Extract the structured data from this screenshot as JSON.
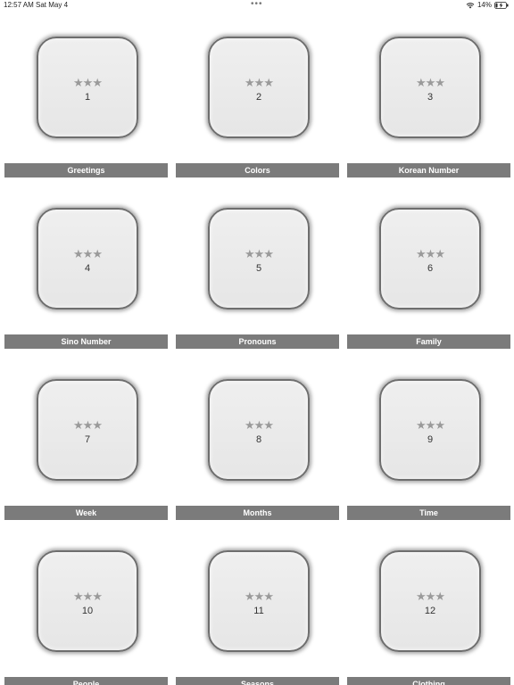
{
  "status": {
    "time": "12:57 AM",
    "date": "Sat May 4",
    "battery": "14%"
  },
  "stars_glyph": "★★★",
  "tiles": [
    {
      "number": "1",
      "label": "Greetings"
    },
    {
      "number": "2",
      "label": "Colors"
    },
    {
      "number": "3",
      "label": "Korean Number"
    },
    {
      "number": "4",
      "label": "Sino Number"
    },
    {
      "number": "5",
      "label": "Pronouns"
    },
    {
      "number": "6",
      "label": "Family"
    },
    {
      "number": "7",
      "label": "Week"
    },
    {
      "number": "8",
      "label": "Months"
    },
    {
      "number": "9",
      "label": "Time"
    },
    {
      "number": "10",
      "label": "People"
    },
    {
      "number": "11",
      "label": "Seasons"
    },
    {
      "number": "12",
      "label": "Clothing"
    }
  ]
}
